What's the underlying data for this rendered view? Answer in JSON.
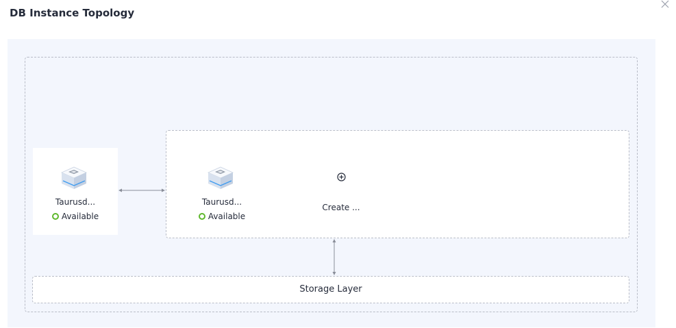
{
  "dialog": {
    "title": "DB Instance Topology"
  },
  "topology": {
    "primary_node": {
      "name": "Taurusd...",
      "status": "Available"
    },
    "replica_node": {
      "name": "Taurusd...",
      "status": "Available"
    },
    "create_node": {
      "label": "Create ..."
    },
    "storage_layer": {
      "label": "Storage Layer"
    }
  },
  "colors": {
    "canvas_background": "#f3f6fd",
    "status_available": "#5eb82c",
    "dashed_border": "#b8bcc7",
    "text": "#252b3a"
  },
  "icons": {
    "close": "close-icon",
    "database": "database-instance-icon",
    "add": "add-circle-icon",
    "status": "status-available-icon"
  }
}
